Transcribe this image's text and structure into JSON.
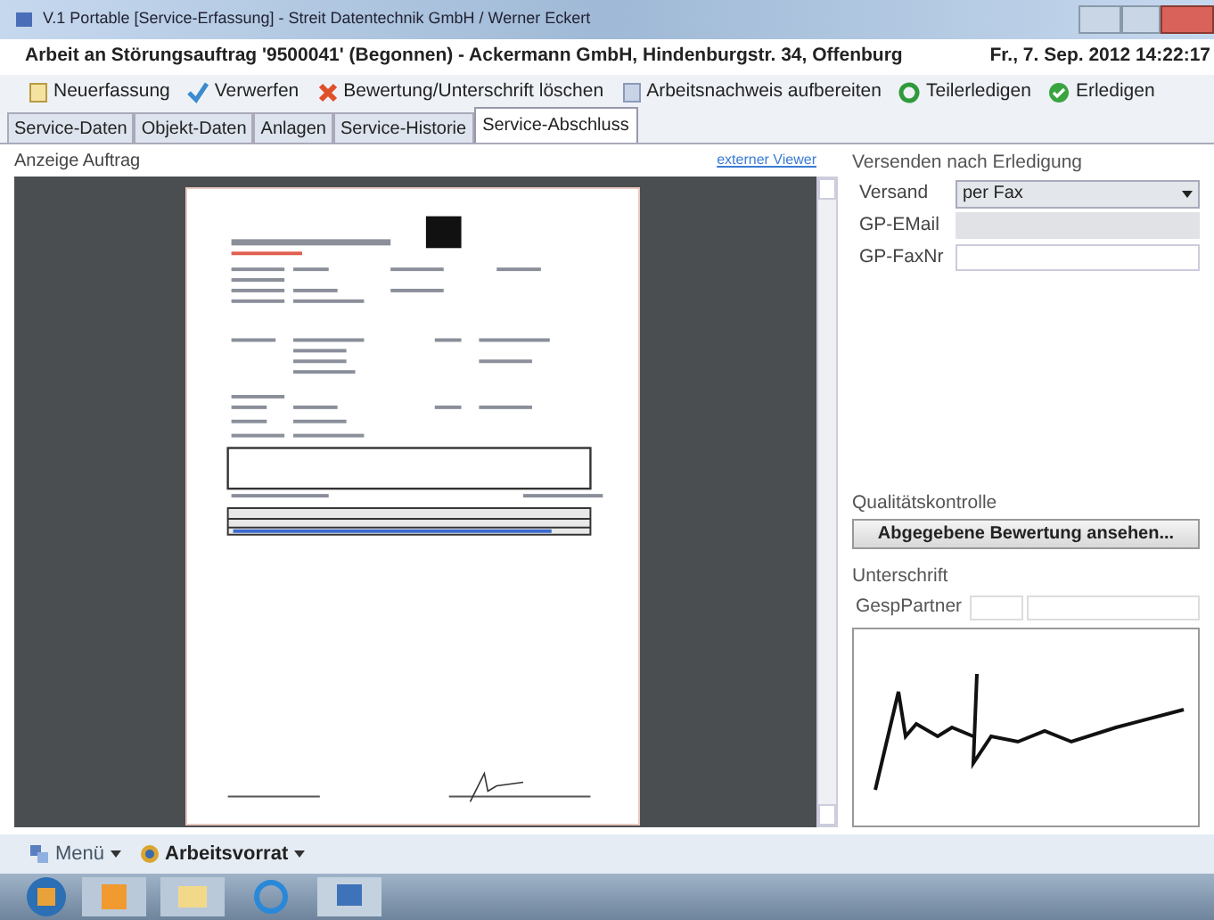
{
  "window": {
    "title": "V.1 Portable [Service-Erfassung] - Streit Datentechnik GmbH / Werner Eckert"
  },
  "header": {
    "title": "Arbeit an Störungsauftrag '9500041' (Begonnen) - Ackermann GmbH, Hindenburgstr. 34, Offenburg",
    "datetime": "Fr., 7. Sep. 2012 14:22:17"
  },
  "toolbar": [
    {
      "label": "Neuerfassung",
      "kind": "new"
    },
    {
      "label": "Verwerfen",
      "kind": "discard"
    },
    {
      "label": "Bewertung/Unterschrift löschen",
      "kind": "delete"
    },
    {
      "label": "Arbeitsnachweis aufbereiten",
      "kind": "prepare"
    },
    {
      "label": "Teilerledigen",
      "kind": "ok"
    },
    {
      "label": "Erledigen",
      "kind": "done"
    }
  ],
  "tabs": [
    {
      "label": "Service-Daten",
      "selected": false
    },
    {
      "label": "Objekt-Daten",
      "selected": false
    },
    {
      "label": "Anlagen",
      "selected": false
    },
    {
      "label": "Service-Historie",
      "selected": false
    },
    {
      "label": "Service-Abschluss",
      "selected": true
    }
  ],
  "preview": {
    "title": "Anzeige Auftrag",
    "link": "externer Viewer"
  },
  "send": {
    "title": "Versenden nach Erledigung",
    "fields": [
      {
        "label": "Versand",
        "value": "per Fax",
        "kind": "select"
      },
      {
        "label": "GP-EMail",
        "kind": "disabled"
      },
      {
        "label": "GP-FaxNr",
        "kind": "text"
      }
    ]
  },
  "quality": {
    "title": "Qualitätskontrolle",
    "button": "Abgegebene Bewertung ansehen..."
  },
  "signature": {
    "title": "Unterschrift",
    "label": "GespPartner"
  },
  "bottom_bar": [
    {
      "label": "Menü",
      "kind": "menu"
    },
    {
      "label": "Arbeitsvorrat",
      "kind": "work"
    }
  ]
}
